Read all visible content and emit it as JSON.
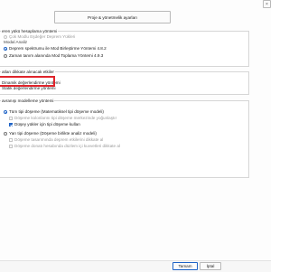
{
  "top_button": {
    "label": "Proje & yönetmelik ayarları"
  },
  "close": {
    "glyph": "×"
  },
  "group1": {
    "title": "eren yükü hesaplama yöntemi",
    "option_disabled_top": "Çok Modlu Eşdeğer Deprem Yükleri",
    "modal_label": "Modal Analiz",
    "radio_a": "Deprem spektrumu ile Mod Birleştirme Yöntemi 4.8.2",
    "radio_b": "Zaman tanım alanında Mod Toplama Yöntemi 4.9.3"
  },
  "group2": {
    "title": "atları dikkate alınacak etkiler",
    "option_dynamic": "Dinamik değerlendirme yöntemi",
    "option_static": "Statik değerlendirme yöntemi"
  },
  "group3": {
    "title": "avranışı modelleme yöntemi",
    "linear_title": "Tüm tipi döşeme (Matematiksel tipi döşeme modeli)",
    "check_a": "Döşeme kolonlarını tipi döşeme merkezinde yoğunlaştır",
    "check_b": "Düşey yükler için tipi döşeme kullan",
    "nonlinear_title": "Yarı tipi döşeme (Döşeme birlikte analiz modeli)",
    "check_c": "Döşeme tasarımında deprem etkilerini dikkate al",
    "check_d": "Döşeme donatı hesabında düzlem içi kuvvetleri dikkate al"
  },
  "footer": {
    "ok": "Tamam",
    "cancel": "İptal"
  },
  "colors": {
    "accent": "#1e63c6",
    "highlight": "#e0242b"
  }
}
